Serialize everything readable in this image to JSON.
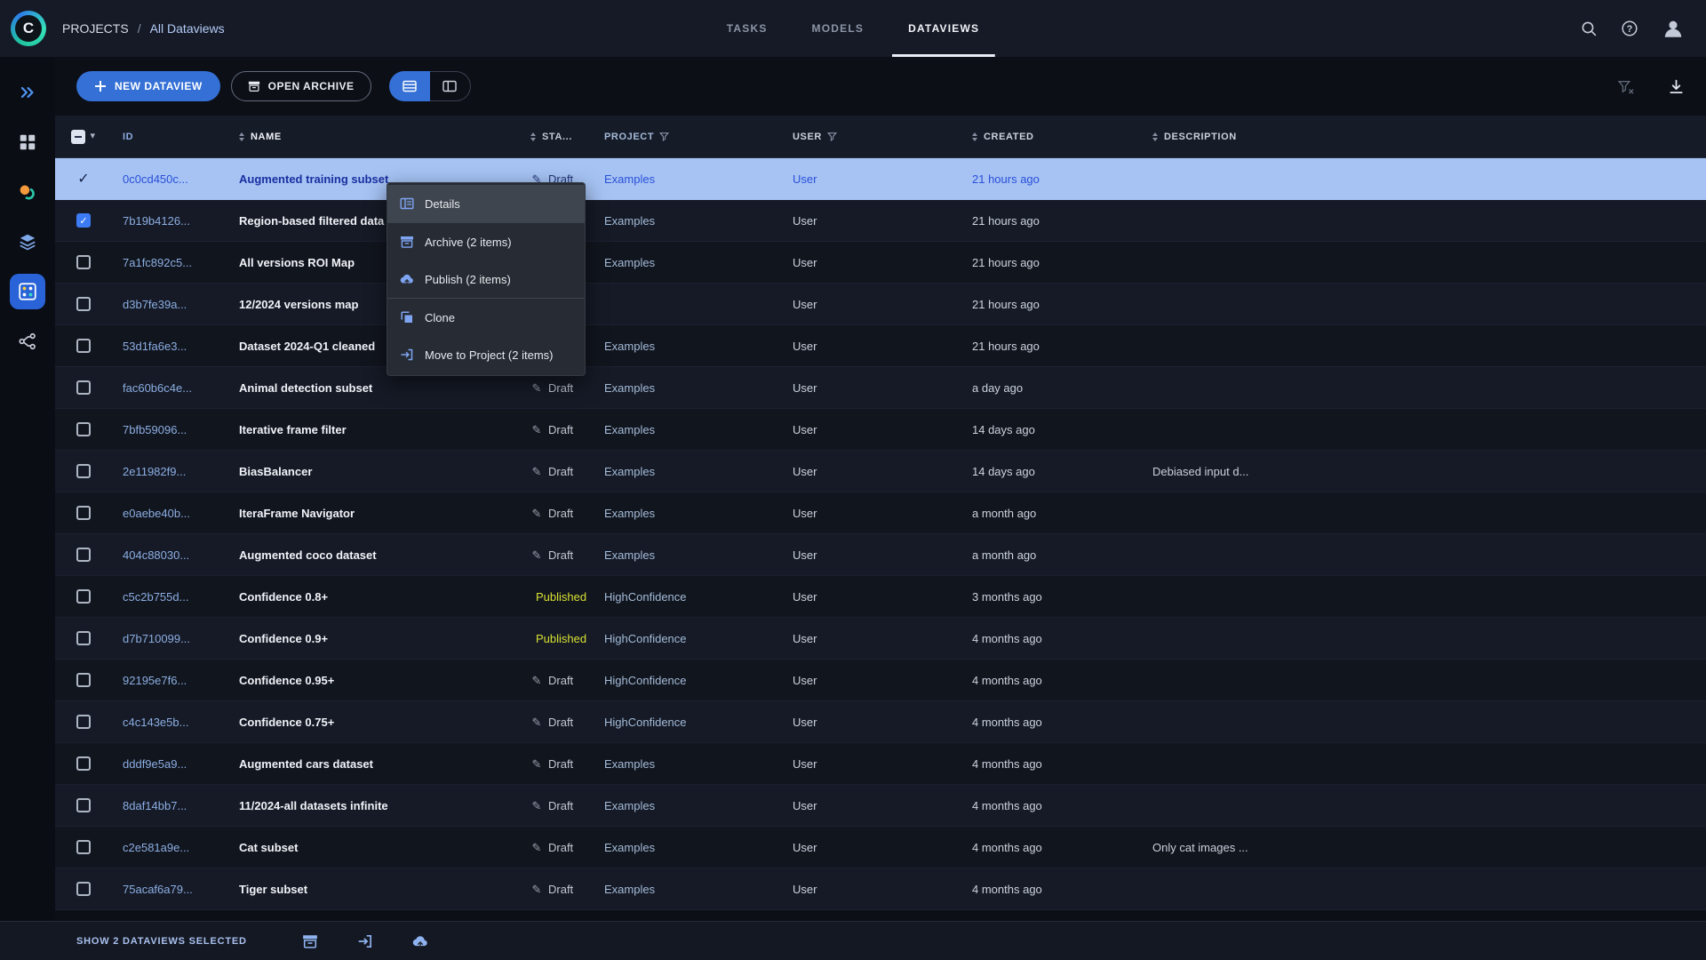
{
  "brand": {
    "logo_letter": "C"
  },
  "colors": {
    "accent_blue": "#3470d6",
    "published_yellow": "#d8e032",
    "selected_row": "#a6c3f4"
  },
  "header": {
    "breadcrumb": [
      {
        "label": "PROJECTS"
      },
      {
        "label": "All Dataviews"
      }
    ],
    "breadcrumb_separator": "/",
    "tabs": [
      {
        "label": "TASKS",
        "active": false
      },
      {
        "label": "MODELS",
        "active": false
      },
      {
        "label": "DATAVIEWS",
        "active": true
      }
    ]
  },
  "sidebar": {
    "items": [
      {
        "name": "getting-started",
        "icon": "chevrons",
        "active": false
      },
      {
        "name": "projects",
        "icon": "grid",
        "active": false
      },
      {
        "name": "datasets",
        "icon": "datasets",
        "active": false
      },
      {
        "name": "layers",
        "icon": "layers",
        "active": false
      },
      {
        "name": "dataviews",
        "icon": "dataviews",
        "active": true
      },
      {
        "name": "pipelines",
        "icon": "pipelines",
        "active": false
      }
    ]
  },
  "toolbar": {
    "new_button_label": "NEW DATAVIEW",
    "archive_button_label": "OPEN ARCHIVE"
  },
  "table": {
    "columns": [
      {
        "key": "id",
        "label": "ID",
        "sort": false,
        "filter": false
      },
      {
        "key": "name",
        "label": "NAME",
        "sort": true,
        "filter": false
      },
      {
        "key": "status",
        "label": "STA...",
        "sort": true,
        "filter": false
      },
      {
        "key": "project",
        "label": "PROJECT",
        "sort": false,
        "filter": true
      },
      {
        "key": "user",
        "label": "USER",
        "sort": false,
        "filter": true
      },
      {
        "key": "created",
        "label": "CREATED",
        "sort": true,
        "filter": false
      },
      {
        "key": "description",
        "label": "DESCRIPTION",
        "sort": true,
        "filter": false
      }
    ],
    "rows": [
      {
        "id": "0c0cd450c...",
        "name": "Augmented training subset",
        "status": "Draft",
        "project": "Examples",
        "user": "User",
        "created": "21 hours ago",
        "description": "",
        "check": "selected",
        "selected": true
      },
      {
        "id": "7b19b4126...",
        "name": "Region-based filtered data",
        "status": "",
        "project": "Examples",
        "user": "User",
        "created": "21 hours ago",
        "description": "",
        "check": "checked",
        "selected": false
      },
      {
        "id": "7a1fc892c5...",
        "name": "All versions ROI Map",
        "status": "",
        "project": "Examples",
        "user": "User",
        "created": "21 hours ago",
        "description": "",
        "check": "none",
        "selected": false
      },
      {
        "id": "d3b7fe39a...",
        "name": "12/2024 versions map",
        "status": "",
        "project": "",
        "user": "User",
        "created": "21 hours ago",
        "description": "",
        "check": "none",
        "selected": false
      },
      {
        "id": "53d1fa6e3...",
        "name": "Dataset 2024-Q1 cleaned",
        "status": "",
        "project": "Examples",
        "user": "User",
        "created": "21 hours ago",
        "description": "",
        "check": "none",
        "selected": false
      },
      {
        "id": "fac60b6c4e...",
        "name": "Animal detection subset",
        "status": "Draft",
        "project": "Examples",
        "user": "User",
        "created": "a day ago",
        "description": "",
        "check": "none",
        "selected": false
      },
      {
        "id": "7bfb59096...",
        "name": "Iterative frame filter",
        "status": "Draft",
        "project": "Examples",
        "user": "User",
        "created": "14 days ago",
        "description": "",
        "check": "none",
        "selected": false
      },
      {
        "id": "2e11982f9...",
        "name": "BiasBalancer",
        "status": "Draft",
        "project": "Examples",
        "user": "User",
        "created": "14 days ago",
        "description": "Debiased input d...",
        "check": "none",
        "selected": false
      },
      {
        "id": "e0aebe40b...",
        "name": "IteraFrame Navigator",
        "status": "Draft",
        "project": "Examples",
        "user": "User",
        "created": "a month ago",
        "description": "",
        "check": "none",
        "selected": false
      },
      {
        "id": "404c88030...",
        "name": "Augmented coco dataset",
        "status": "Draft",
        "project": "Examples",
        "user": "User",
        "created": "a month ago",
        "description": "",
        "check": "none",
        "selected": false
      },
      {
        "id": "c5c2b755d...",
        "name": "Confidence 0.8+",
        "status": "Published",
        "project": "HighConfidence",
        "user": "User",
        "created": "3 months ago",
        "description": "",
        "check": "none",
        "selected": false
      },
      {
        "id": "d7b710099...",
        "name": "Confidence 0.9+",
        "status": "Published",
        "project": "HighConfidence",
        "user": "User",
        "created": "4 months ago",
        "description": "",
        "check": "none",
        "selected": false
      },
      {
        "id": "92195e7f6...",
        "name": "Confidence 0.95+",
        "status": "Draft",
        "project": "HighConfidence",
        "user": "User",
        "created": "4 months ago",
        "description": "",
        "check": "none",
        "selected": false
      },
      {
        "id": "c4c143e5b...",
        "name": "Confidence 0.75+",
        "status": "Draft",
        "project": "HighConfidence",
        "user": "User",
        "created": "4 months ago",
        "description": "",
        "check": "none",
        "selected": false
      },
      {
        "id": "dddf9e5a9...",
        "name": "Augmented cars dataset",
        "status": "Draft",
        "project": "Examples",
        "user": "User",
        "created": "4 months ago",
        "description": "",
        "check": "none",
        "selected": false
      },
      {
        "id": "8daf14bb7...",
        "name": "11/2024-all datasets infinite",
        "status": "Draft",
        "project": "Examples",
        "user": "User",
        "created": "4 months ago",
        "description": "",
        "check": "none",
        "selected": false
      },
      {
        "id": "c2e581a9e...",
        "name": "Cat subset",
        "status": "Draft",
        "project": "Examples",
        "user": "User",
        "created": "4 months ago",
        "description": "Only cat images ...",
        "check": "none",
        "selected": false
      },
      {
        "id": "75acaf6a79...",
        "name": "Tiger subset",
        "status": "Draft",
        "project": "Examples",
        "user": "User",
        "created": "4 months ago",
        "description": "",
        "check": "none",
        "selected": false
      }
    ]
  },
  "context_menu": {
    "items": [
      {
        "label": "Details",
        "icon": "details",
        "highlight": true,
        "divider_after": true
      },
      {
        "label": "Archive (2 items)",
        "icon": "archive",
        "highlight": false,
        "divider_after": false
      },
      {
        "label": "Publish (2 items)",
        "icon": "publish",
        "highlight": false,
        "divider_after": true
      },
      {
        "label": "Clone",
        "icon": "clone",
        "highlight": false,
        "divider_after": false
      },
      {
        "label": "Move to Project (2 items)",
        "icon": "move",
        "highlight": false,
        "divider_after": false
      }
    ]
  },
  "footer": {
    "label": "SHOW 2 DATAVIEWS SELECTED",
    "actions": [
      {
        "name": "archive-selected",
        "icon": "archive"
      },
      {
        "name": "move-selected-to-project",
        "icon": "move"
      },
      {
        "name": "publish-selected",
        "icon": "publish"
      }
    ]
  }
}
